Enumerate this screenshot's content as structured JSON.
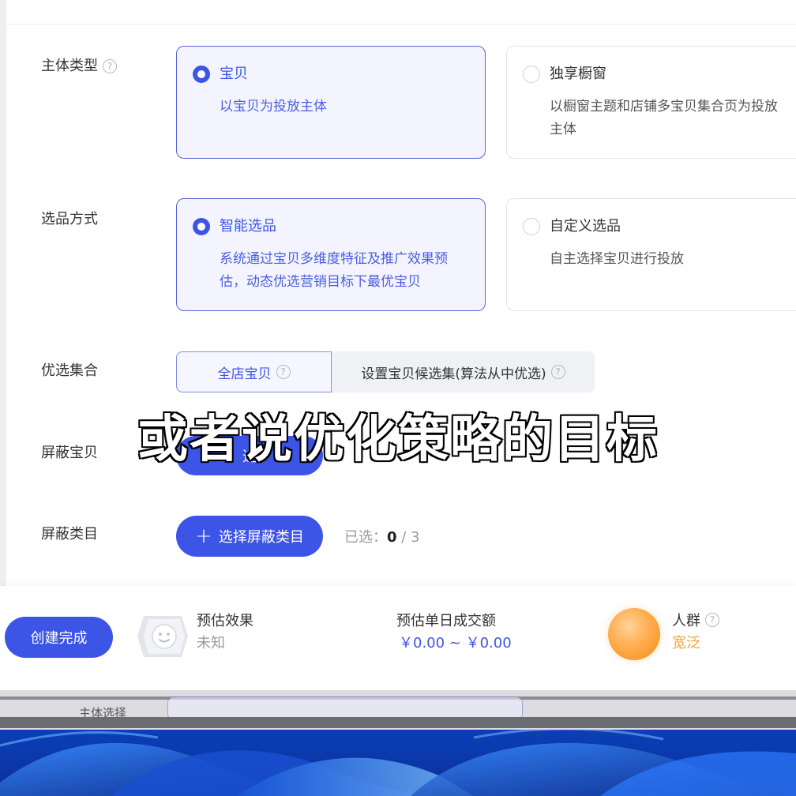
{
  "rows": {
    "subject": {
      "label": "主体类型"
    },
    "selection": {
      "label": "选品方式"
    },
    "preferred": {
      "label": "优选集合"
    },
    "block_items": {
      "label": "屏蔽宝贝"
    },
    "block_category": {
      "label": "屏蔽类目"
    }
  },
  "subject_cards": [
    {
      "title": "宝贝",
      "desc": "以宝贝为投放主体",
      "selected": true
    },
    {
      "title": "独享橱窗",
      "desc": "以橱窗主题和店铺多宝贝集合页为投放主体",
      "selected": false
    }
  ],
  "selection_cards": [
    {
      "title": "智能选品",
      "desc": "系统通过宝贝多维度特征及推广效果预估，动态优选营销目标下最优宝贝",
      "selected": true
    },
    {
      "title": "自定义选品",
      "desc": "自主选择宝贝进行投放",
      "selected": false
    }
  ],
  "preferred_options": [
    {
      "label": "全店宝贝",
      "active": true
    },
    {
      "label": "设置宝贝候选集(算法从中优选)",
      "active": false
    }
  ],
  "block_items_button": {
    "label_partial": "选"
  },
  "block_category_button": {
    "label": "选择屏蔽类目"
  },
  "block_category_counter": {
    "prefix": "已选：",
    "selected": "0",
    "separator": " / ",
    "max": "3"
  },
  "subtitle": "或者说优化策略的目标",
  "footer": {
    "create_button": "创建完成",
    "estimate": {
      "label": "预估效果",
      "value": "未知"
    },
    "daily_gmv": {
      "label": "预估单日成交额",
      "value": "￥0.00 ~ ￥0.00"
    },
    "crowd": {
      "label": "人群",
      "value": "宽泛"
    }
  },
  "background_window": {
    "partial_label": "主体选择"
  },
  "colors": {
    "primary": "#3d55e6",
    "crowd_value": "#f2a233",
    "muted": "#9a9aa3"
  }
}
